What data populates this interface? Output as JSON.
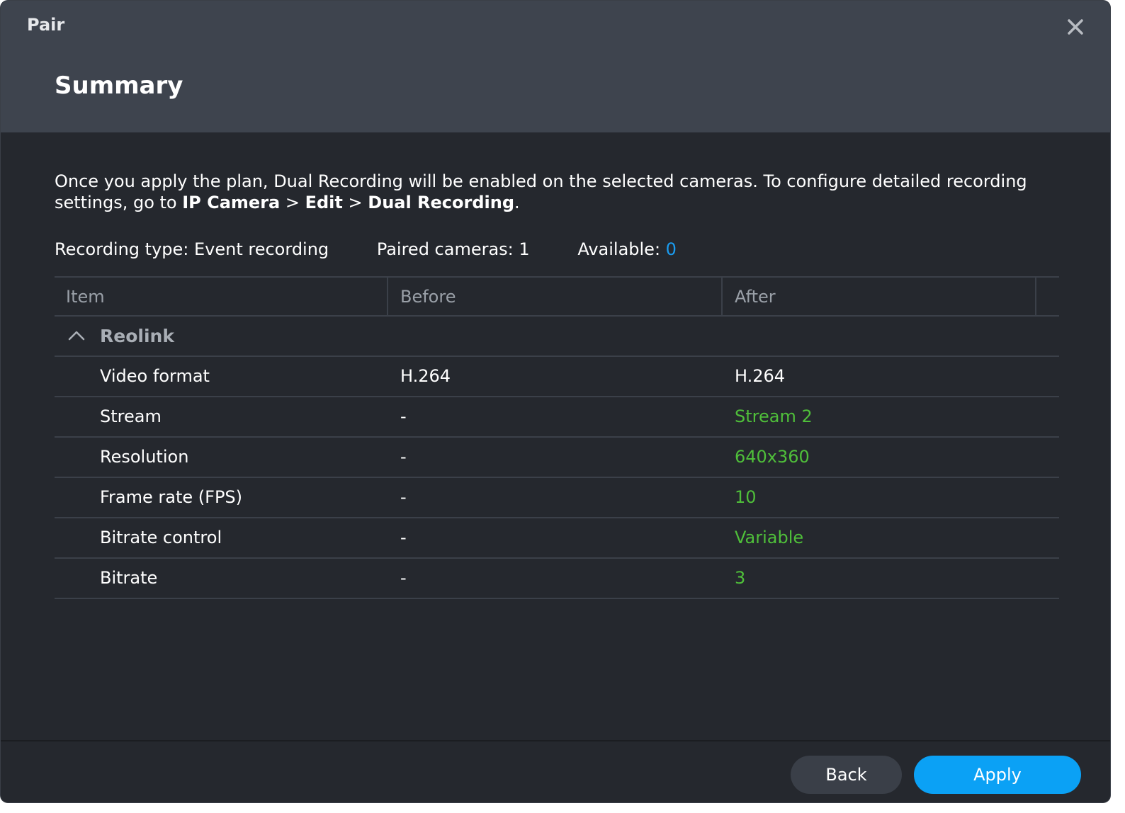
{
  "window": {
    "title": "Pair"
  },
  "header": {
    "title": "Summary"
  },
  "description": {
    "text_before": "Once you apply the plan, Dual Recording will be enabled on the selected cameras. To configure detailed recording settings, go to ",
    "path_1": "IP Camera",
    "sep_1": " > ",
    "path_2": "Edit",
    "sep_2": " > ",
    "path_3": "Dual Recording",
    "text_after": "."
  },
  "stats": {
    "recording_type_label": "Recording type: ",
    "recording_type_value": "Event recording",
    "paired_label": "Paired cameras: ",
    "paired_value": "1",
    "available_label": "Available: ",
    "available_value": "0"
  },
  "table": {
    "columns": {
      "item": "Item",
      "before": "Before",
      "after": "After"
    },
    "group": "Reolink",
    "rows": [
      {
        "item": "Video format",
        "before": "H.264",
        "after": "H.264",
        "changed": false
      },
      {
        "item": "Stream",
        "before": "-",
        "after": "Stream 2",
        "changed": true
      },
      {
        "item": "Resolution",
        "before": "-",
        "after": "640x360",
        "changed": true
      },
      {
        "item": "Frame rate (FPS)",
        "before": "-",
        "after": "10",
        "changed": true
      },
      {
        "item": "Bitrate control",
        "before": "-",
        "after": "Variable",
        "changed": true
      },
      {
        "item": "Bitrate",
        "before": "-",
        "after": "3",
        "changed": true
      }
    ]
  },
  "footer": {
    "back_label": "Back",
    "apply_label": "Apply"
  },
  "colors": {
    "accent": "#0ba1f5",
    "changed_value": "#4fbf3a",
    "available_value": "#1a9cf0"
  },
  "icons": {
    "close": "close-icon",
    "collapse": "chevron-up-icon"
  }
}
